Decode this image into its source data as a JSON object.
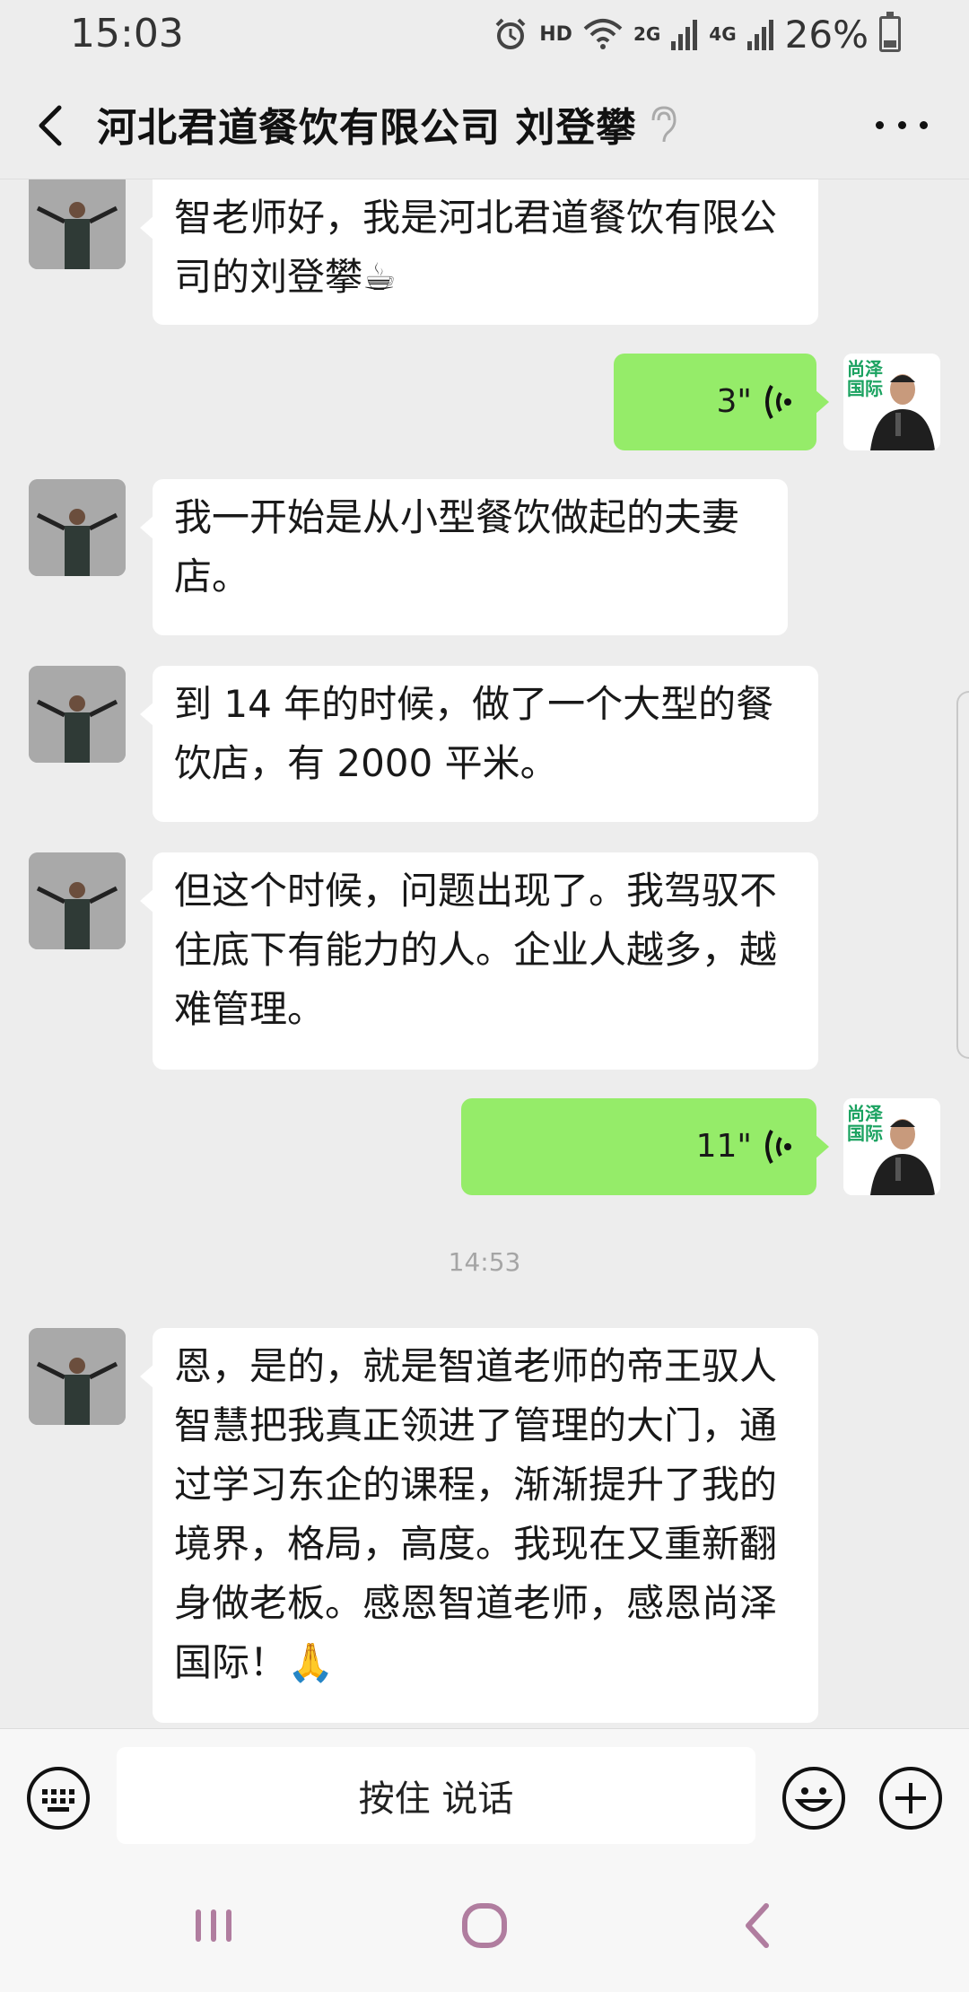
{
  "status_bar": {
    "time": "15:03",
    "hd_label": "HD",
    "net1": "2G",
    "net2": "4G",
    "battery": "26%"
  },
  "header": {
    "title": "河北君道餐饮有限公司  刘登攀"
  },
  "messages": [
    {
      "side": "left",
      "type": "text",
      "lines": [
        "智老师好，我是河北君道餐饮有限公",
        "司的刘登攀☕"
      ]
    },
    {
      "side": "right",
      "type": "voice",
      "duration": "3\""
    },
    {
      "side": "left",
      "type": "text",
      "lines": [
        "我一开始是从小型餐饮做起的夫妻",
        "店。"
      ]
    },
    {
      "side": "left",
      "type": "text",
      "lines": [
        "到 14 年的时候，做了一个大型的餐",
        "饮店，有 2000 平米。"
      ]
    },
    {
      "side": "left",
      "type": "text",
      "lines": [
        "但这个时候，问题出现了。我驾驭不",
        "住底下有能力的人。企业人越多，越",
        "难管理。"
      ]
    },
    {
      "side": "right",
      "type": "voice",
      "duration": "11\""
    },
    {
      "type": "time",
      "text": "14:53"
    },
    {
      "side": "left",
      "type": "text",
      "lines": [
        "恩，是的，就是智道老师的帝王驭人",
        "智慧把我真正领进了管理的大门，通",
        "过学习东企的课程，渐渐提升了我的",
        "境界，格局，高度。我现在又重新翻",
        "身做老板。感恩智道老师，感恩尚泽",
        "国际！🙏"
      ]
    }
  ],
  "self_avatar_text": [
    "尚泽",
    "国际"
  ],
  "input_bar": {
    "hold_to_talk": "按住 说话"
  },
  "colors": {
    "background": "#ededed",
    "voice_bubble": "#95ec69",
    "logo_green": "#1aa260"
  }
}
